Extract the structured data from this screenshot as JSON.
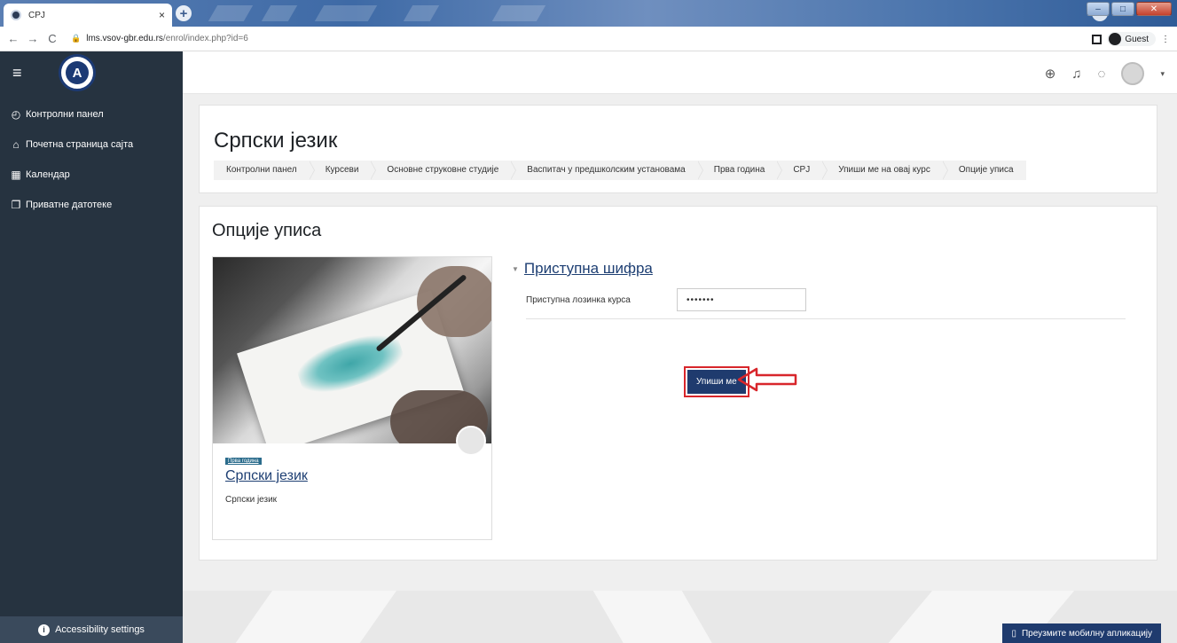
{
  "browser": {
    "tab_title": "CPJ",
    "tab_close": "×",
    "new_tab": "+",
    "url_host": "lms.vsov-gbr.edu.rs",
    "url_path": "/enrol/index.php?id=6",
    "profile_label": "Guest"
  },
  "sidebar": {
    "items": [
      {
        "label": "Контролни панел"
      },
      {
        "label": "Почетна страница сајта"
      },
      {
        "label": "Календар"
      },
      {
        "label": "Приватне датотеке"
      }
    ],
    "accessibility": "Accessibility settings"
  },
  "header": {
    "title": "Српски језик",
    "breadcrumb": [
      "Контролни панел",
      "Курсеви",
      "Основне струковне студије",
      "Васпитач у предшколским установама",
      "Прва година",
      "CPJ",
      "Упиши ме на овај курс",
      "Опције уписа"
    ]
  },
  "main": {
    "section_title": "Опције уписа",
    "course": {
      "badge": "Прва година",
      "name": "Српски језик",
      "summary": "Српски језик"
    },
    "enrol": {
      "legend": "Приступна шифра",
      "password_label": "Приступна лозинка курса",
      "password_value": "•••••••",
      "button": "Упиши ме"
    }
  },
  "footer": {
    "mobile_app": "Преузмите мобилну апликацију"
  },
  "colors": {
    "sidebar_bg": "#263340",
    "primary": "#1f3b6e",
    "highlight": "#d8262b"
  }
}
